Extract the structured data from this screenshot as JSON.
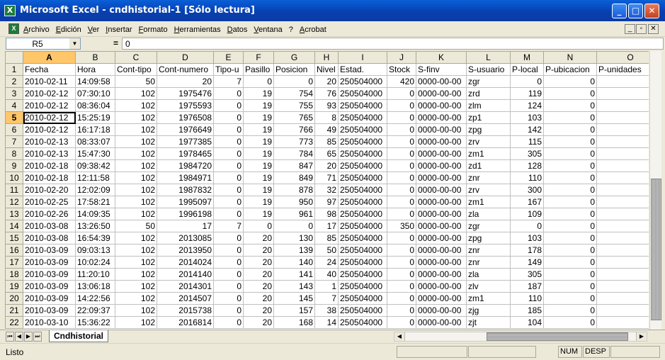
{
  "window": {
    "title": "Microsoft Excel - cndhistorial-1  [Sólo lectura]",
    "icon": "excel-icon",
    "minimize_label": "_",
    "maximize_label": "□",
    "close_label": "✕"
  },
  "menubar": {
    "items": [
      "Archivo",
      "Edición",
      "Ver",
      "Insertar",
      "Formato",
      "Herramientas",
      "Datos",
      "Ventana",
      "?",
      "Acrobat"
    ],
    "mdi_min": "_",
    "mdi_restore": "▫",
    "mdi_close": "✕"
  },
  "formula": {
    "name_box": "R5",
    "equals": "=",
    "value": "0"
  },
  "sheet": {
    "active_row": "5",
    "active_column": "A",
    "column_letters": [
      "A",
      "B",
      "C",
      "D",
      "E",
      "F",
      "G",
      "H",
      "I",
      "J",
      "K",
      "L",
      "M",
      "N",
      "O"
    ],
    "rows": [
      [
        "1",
        "Fecha",
        "Hora",
        "Cont-tipo",
        "Cont-numero",
        "Tipo-u",
        "Pasillo",
        "Posicion",
        "Nivel",
        "Estad.",
        "Stock",
        "S-finv",
        "S-usuario",
        "P-local",
        "P-ubicacion",
        "P-unidades"
      ],
      [
        "2",
        "2010-02-11",
        "14:09:58",
        "50",
        "20",
        "7",
        "0",
        "0",
        "20",
        "250504000",
        "420",
        "0000-00-00",
        "zgr",
        "0",
        "0",
        "0"
      ],
      [
        "3",
        "2010-02-12",
        "07:30:10",
        "102",
        "1975476",
        "0",
        "19",
        "754",
        "76",
        "250504000",
        "0",
        "0000-00-00",
        "zrd",
        "119",
        "0",
        "70"
      ],
      [
        "4",
        "2010-02-12",
        "08:36:04",
        "102",
        "1975593",
        "0",
        "19",
        "755",
        "93",
        "250504000",
        "0",
        "0000-00-00",
        "zlm",
        "124",
        "0",
        "35"
      ],
      [
        "5",
        "2010-02-12",
        "15:25:19",
        "102",
        "1976508",
        "0",
        "19",
        "765",
        "8",
        "250504000",
        "0",
        "0000-00-00",
        "zp1",
        "103",
        "0",
        "35"
      ],
      [
        "6",
        "2010-02-12",
        "16:17:18",
        "102",
        "1976649",
        "0",
        "19",
        "766",
        "49",
        "250504000",
        "0",
        "0000-00-00",
        "zpg",
        "142",
        "0",
        "35"
      ],
      [
        "7",
        "2010-02-13",
        "08:33:07",
        "102",
        "1977385",
        "0",
        "19",
        "773",
        "85",
        "250504000",
        "0",
        "0000-00-00",
        "zrv",
        "115",
        "0",
        "35"
      ],
      [
        "8",
        "2010-02-13",
        "15:47:30",
        "102",
        "1978465",
        "0",
        "19",
        "784",
        "65",
        "250504000",
        "0",
        "0000-00-00",
        "zm1",
        "305",
        "0",
        "35"
      ],
      [
        "9",
        "2010-02-18",
        "09:38:42",
        "102",
        "1984720",
        "0",
        "19",
        "847",
        "20",
        "250504000",
        "0",
        "0000-00-00",
        "zd1",
        "128",
        "0",
        "35"
      ],
      [
        "10",
        "2010-02-18",
        "12:11:58",
        "102",
        "1984971",
        "0",
        "19",
        "849",
        "71",
        "250504000",
        "0",
        "0000-00-00",
        "znr",
        "110",
        "0",
        "35"
      ],
      [
        "11",
        "2010-02-20",
        "12:02:09",
        "102",
        "1987832",
        "0",
        "19",
        "878",
        "32",
        "250504000",
        "0",
        "0000-00-00",
        "zrv",
        "300",
        "0",
        "35"
      ],
      [
        "12",
        "2010-02-25",
        "17:58:21",
        "102",
        "1995097",
        "0",
        "19",
        "950",
        "97",
        "250504000",
        "0",
        "0000-00-00",
        "zm1",
        "167",
        "0",
        "35"
      ],
      [
        "13",
        "2010-02-26",
        "14:09:35",
        "102",
        "1996198",
        "0",
        "19",
        "961",
        "98",
        "250504000",
        "0",
        "0000-00-00",
        "zla",
        "109",
        "0",
        "35"
      ],
      [
        "14",
        "2010-03-08",
        "13:26:50",
        "50",
        "17",
        "7",
        "0",
        "0",
        "17",
        "250504000",
        "350",
        "0000-00-00",
        "zgr",
        "0",
        "0",
        "0"
      ],
      [
        "15",
        "2010-03-08",
        "16:54:39",
        "102",
        "2013085",
        "0",
        "20",
        "130",
        "85",
        "250504000",
        "0",
        "0000-00-00",
        "zpg",
        "103",
        "0",
        "35"
      ],
      [
        "16",
        "2010-03-09",
        "09:03:13",
        "102",
        "2013950",
        "0",
        "20",
        "139",
        "50",
        "250504000",
        "0",
        "0000-00-00",
        "znr",
        "178",
        "0",
        "35"
      ],
      [
        "17",
        "2010-03-09",
        "10:02:24",
        "102",
        "2014024",
        "0",
        "20",
        "140",
        "24",
        "250504000",
        "0",
        "0000-00-00",
        "znr",
        "149",
        "0",
        "35"
      ],
      [
        "18",
        "2010-03-09",
        "11:20:10",
        "102",
        "2014140",
        "0",
        "20",
        "141",
        "40",
        "250504000",
        "0",
        "0000-00-00",
        "zla",
        "305",
        "0",
        "35"
      ],
      [
        "19",
        "2010-03-09",
        "13:06:18",
        "102",
        "2014301",
        "0",
        "20",
        "143",
        "1",
        "250504000",
        "0",
        "0000-00-00",
        "zlv",
        "187",
        "0",
        "35"
      ],
      [
        "20",
        "2010-03-09",
        "14:22:56",
        "102",
        "2014507",
        "0",
        "20",
        "145",
        "7",
        "250504000",
        "0",
        "0000-00-00",
        "zm1",
        "110",
        "0",
        "35"
      ],
      [
        "21",
        "2010-03-09",
        "22:09:37",
        "102",
        "2015738",
        "0",
        "20",
        "157",
        "38",
        "250504000",
        "0",
        "0000-00-00",
        "zjg",
        "185",
        "0",
        "35"
      ],
      [
        "22",
        "2010-03-10",
        "15:36:22",
        "102",
        "2016814",
        "0",
        "20",
        "168",
        "14",
        "250504000",
        "0",
        "0000-00-00",
        "zjt",
        "104",
        "0",
        "35"
      ]
    ]
  },
  "tabs": {
    "nav_first": "⏮",
    "nav_prev": "◀",
    "nav_next": "▶",
    "nav_last": "⏭",
    "active_sheet": "Cndhistorial"
  },
  "status": {
    "mode": "Listo",
    "num": "NUM",
    "desp": "DESP"
  }
}
